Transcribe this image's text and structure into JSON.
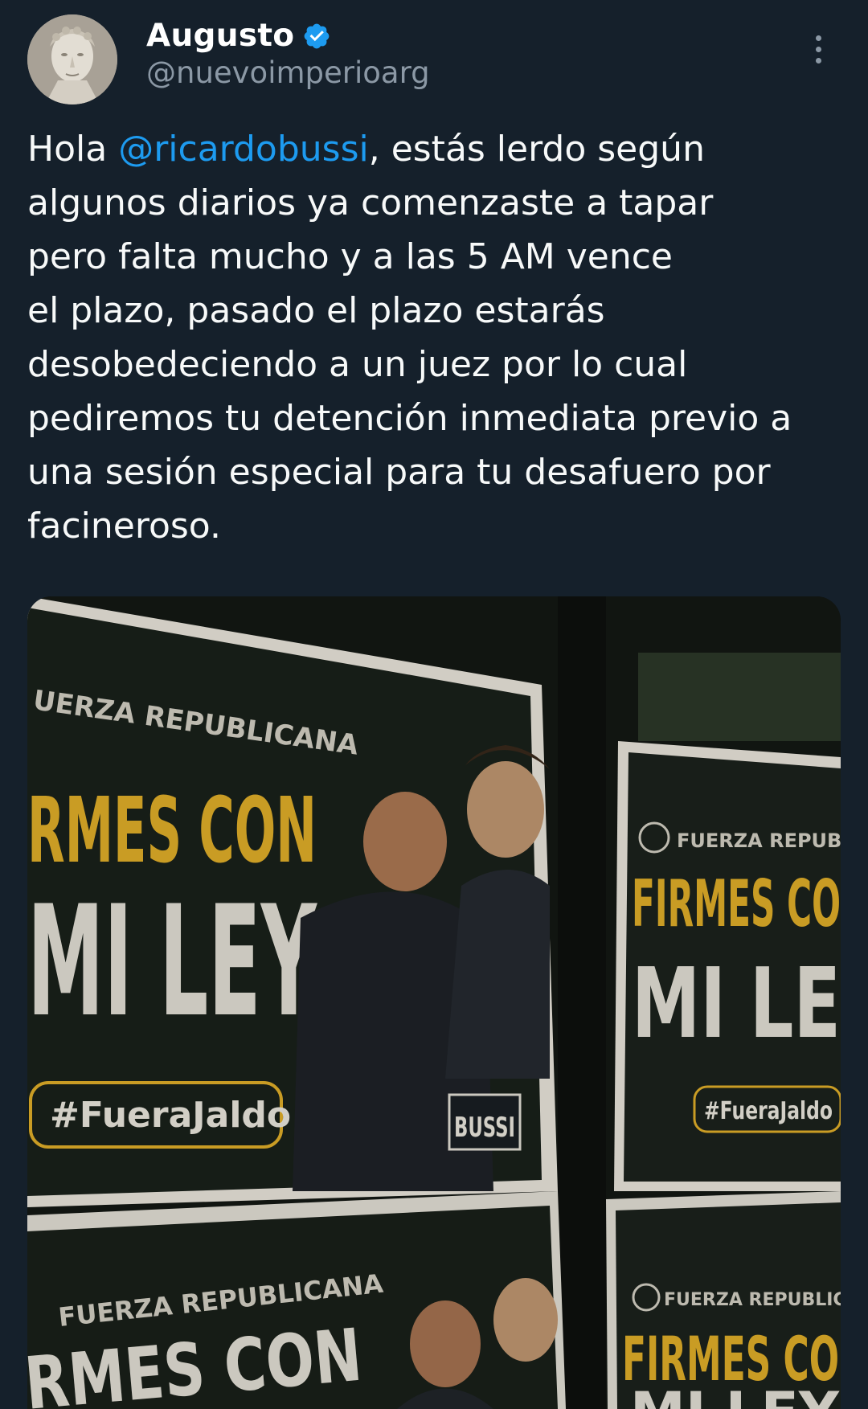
{
  "author": {
    "display_name": "Augusto",
    "handle": "@nuevoimperioarg",
    "verified": true,
    "avatar_icon": "roman-bust-avatar"
  },
  "tweet": {
    "lines": [
      {
        "pre": "Hola ",
        "mention": "@ricardobussi",
        "post": ", estás lerdo según"
      },
      {
        "text": "algunos diarios ya comenzaste a tapar"
      },
      {
        "text": "pero falta mucho y a las 5 AM  vence"
      },
      {
        "text": "el plazo, pasado el plazo estarás"
      },
      {
        "text": "desobedeciendo a un juez por lo cual"
      },
      {
        "text": "pediremos tu detención inmediata previo a"
      },
      {
        "text": "una sesión especial para tu desafuero por"
      },
      {
        "text": "facineroso."
      }
    ]
  },
  "media": {
    "poster_main": {
      "party": "UERZA REPUBLICANA",
      "slogan_1": "RMES CON",
      "slogan_2": "MI LEY",
      "hashtag": "#FueraJaldo",
      "brand": "BUSSI"
    },
    "poster_right": {
      "party": "FUERZA REPUBLI",
      "slogan_1": "FIRMES CO",
      "slogan_2": "MI LE",
      "hashtag": "#FueraJaldo"
    },
    "poster_bottom_left": {
      "party": "FUERZA REPUBLICANA",
      "slogan_1": "RMES CON"
    },
    "poster_bottom_right": {
      "party": "FUERZA REPUBLICA",
      "slogan_1": "FIRMES CO",
      "slogan_2": "MI LEY"
    }
  },
  "colors": {
    "background": "#15202b",
    "link": "#1d9bf0",
    "secondary_text": "#8b98a5",
    "poster_yellow": "#e5b22a"
  }
}
